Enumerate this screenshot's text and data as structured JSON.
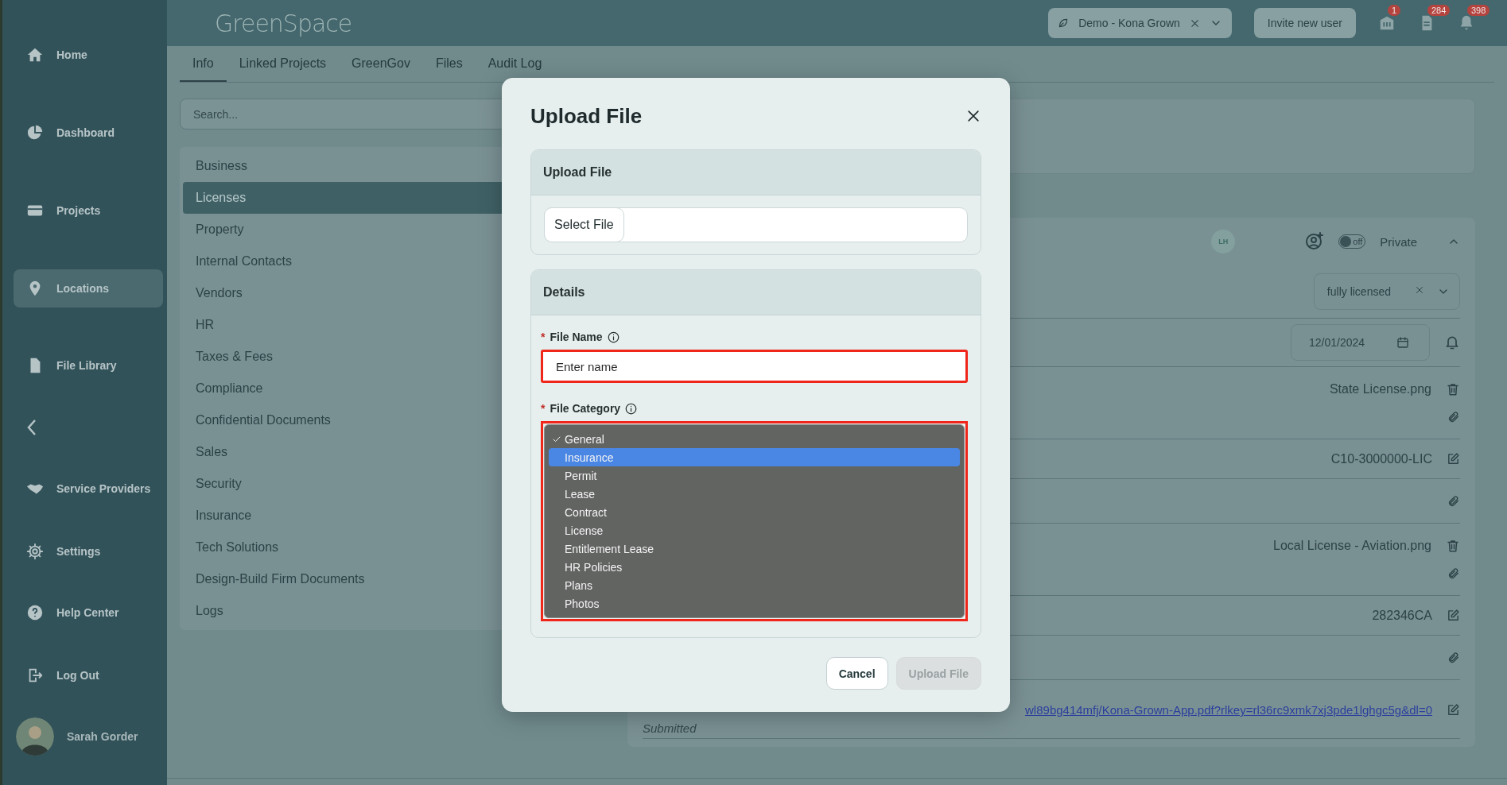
{
  "sidebar": {
    "items": [
      {
        "label": "Home",
        "selected": false
      },
      {
        "label": "Dashboard",
        "selected": false
      },
      {
        "label": "Projects",
        "selected": false
      },
      {
        "label": "Locations",
        "selected": true
      },
      {
        "label": "File Library",
        "selected": false
      },
      {
        "label": "Service Providers",
        "selected": false
      },
      {
        "label": "Settings",
        "selected": false
      },
      {
        "label": "Help Center",
        "selected": false
      },
      {
        "label": "Log Out",
        "selected": false
      }
    ],
    "user": {
      "name": "Sarah Gorder"
    }
  },
  "header": {
    "logo": "GreenSpace",
    "org_select": {
      "value": "Demo - Kona Grown"
    },
    "invite_button": "Invite new user",
    "notifications": [
      {
        "count": "1"
      },
      {
        "count": "284"
      },
      {
        "count": "398"
      }
    ]
  },
  "tabs": [
    {
      "label": "Info",
      "selected": true
    },
    {
      "label": "Linked Projects",
      "selected": false
    },
    {
      "label": "GreenGov",
      "selected": false
    },
    {
      "label": "Files",
      "selected": false
    },
    {
      "label": "Audit Log",
      "selected": false
    }
  ],
  "search": {
    "placeholder": "Search..."
  },
  "categories": [
    {
      "label": "Business",
      "selected": false
    },
    {
      "label": "Licenses",
      "selected": true
    },
    {
      "label": "Property",
      "selected": false
    },
    {
      "label": "Internal Contacts",
      "selected": false
    },
    {
      "label": "Vendors",
      "selected": false
    },
    {
      "label": "HR",
      "selected": false
    },
    {
      "label": "Taxes & Fees",
      "selected": false
    },
    {
      "label": "Compliance",
      "selected": false
    },
    {
      "label": "Confidential Documents",
      "selected": false
    },
    {
      "label": "Sales",
      "selected": false
    },
    {
      "label": "Security",
      "selected": false
    },
    {
      "label": "Insurance",
      "selected": false
    },
    {
      "label": "Tech Solutions",
      "selected": false
    },
    {
      "label": "Design-Build Firm Documents",
      "selected": false
    },
    {
      "label": "Logs",
      "selected": false
    }
  ],
  "record": {
    "avatar_initials": "LH",
    "visibility_toggle": {
      "on": false,
      "label": "off"
    },
    "visibility": "Private",
    "status_select": {
      "value": "fully licensed"
    },
    "date": "12/01/2024",
    "rows": [
      {
        "kind": "file",
        "text": "State License.png"
      },
      {
        "kind": "text",
        "text": "C10-3000000-LIC"
      },
      {
        "kind": "attachment"
      },
      {
        "kind": "file",
        "text": "Local License - Aviation.png"
      },
      {
        "kind": "text",
        "text": "282346CA"
      },
      {
        "kind": "attachment"
      },
      {
        "kind": "link",
        "text": "wl89bg414mfj/Kona-Grown-App.pdf?rlkey=rl36rc9xmk7xj3pde1lghgc5g&dl=0",
        "note": "Submitted"
      }
    ]
  },
  "dialog": {
    "title": "Upload File",
    "upload_section": {
      "title": "Upload File",
      "select_button": "Select File"
    },
    "details_section": {
      "title": "Details",
      "file_name": {
        "label": "File Name",
        "required_mark": "*",
        "invalid": true,
        "placeholder": "Enter name"
      },
      "file_category": {
        "label": "File Category",
        "required_mark": "*",
        "invalid": true,
        "options": [
          {
            "label": "General",
            "checked": true,
            "highlighted": false
          },
          {
            "label": "Insurance",
            "checked": false,
            "highlighted": true
          },
          {
            "label": "Permit",
            "checked": false,
            "highlighted": false
          },
          {
            "label": "Lease",
            "checked": false,
            "highlighted": false
          },
          {
            "label": "Contract",
            "checked": false,
            "highlighted": false
          },
          {
            "label": "License",
            "checked": false,
            "highlighted": false
          },
          {
            "label": "Entitlement Lease",
            "checked": false,
            "highlighted": false
          },
          {
            "label": "HR Policies",
            "checked": false,
            "highlighted": false
          },
          {
            "label": "Plans",
            "checked": false,
            "highlighted": false
          },
          {
            "label": "Photos",
            "checked": false,
            "highlighted": false
          }
        ]
      }
    },
    "buttons": [
      {
        "label": "Cancel",
        "disabled": false
      },
      {
        "label": "Upload File",
        "disabled": true
      }
    ]
  }
}
